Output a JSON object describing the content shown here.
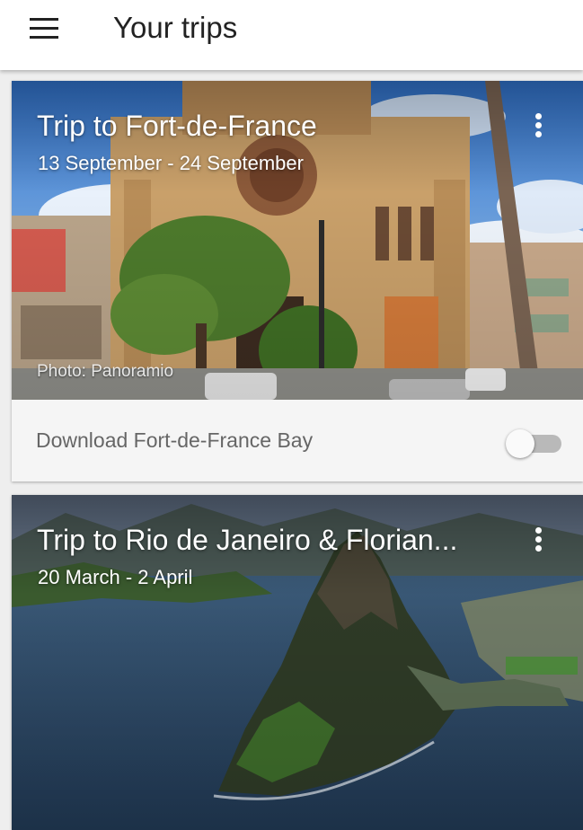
{
  "appbar": {
    "menu_icon": "hamburger-menu-icon",
    "title": "Your trips"
  },
  "trips": [
    {
      "title": "Trip to Fort-de-France",
      "dates": "13 September - 24 September",
      "photo_credit": "Photo: Panoramio",
      "more_icon": "more-vert-icon",
      "download_label": "Download Fort-de-France Bay",
      "download_enabled": false
    },
    {
      "title": "Trip to Rio de Janeiro & Florian...",
      "dates": "20 March - 2 April",
      "more_icon": "more-vert-icon"
    }
  ],
  "colors": {
    "appbar_bg": "#ffffff",
    "card_bg": "#f5f5f5",
    "page_bg": "#eeeeee",
    "toggle_track_off": "#b9b9b9",
    "title_text": "#222222",
    "secondary_text": "#666666"
  }
}
